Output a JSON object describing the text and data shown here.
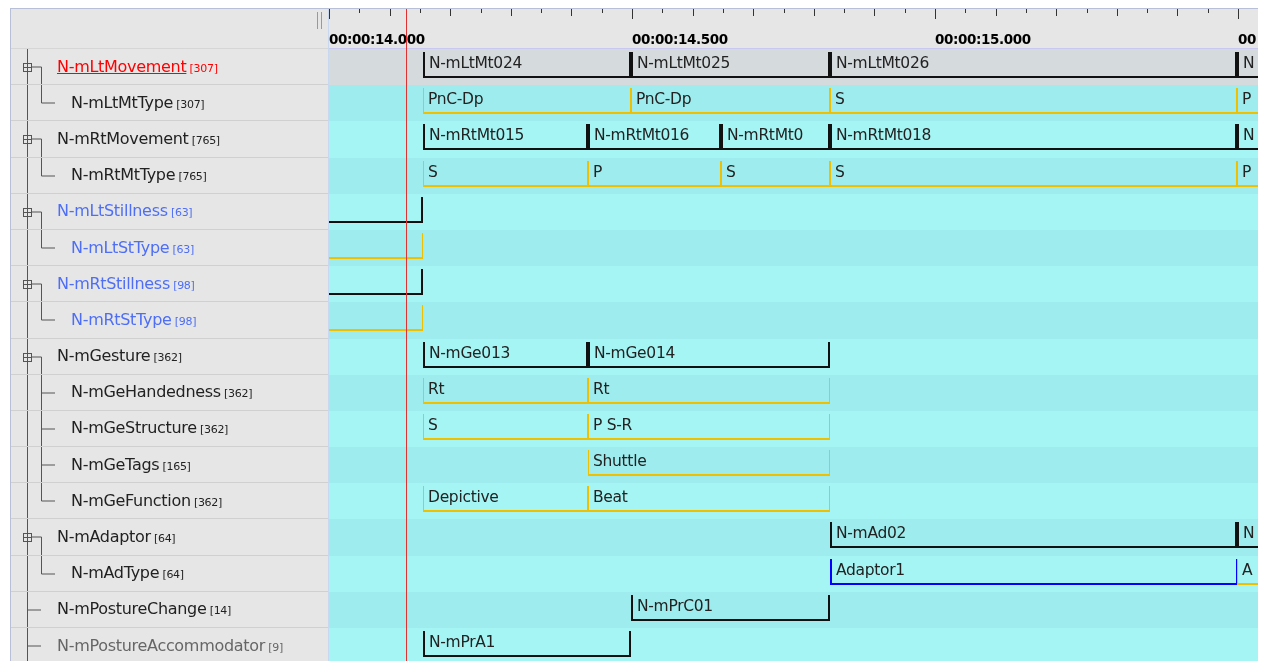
{
  "ruler": {
    "labels": [
      {
        "text": "00:00:14.000"
      },
      {
        "text": "00:00:14.500"
      },
      {
        "text": "00:00:15.000"
      },
      {
        "text": "00"
      }
    ]
  },
  "tiers": [
    {
      "name": "N-mLtMovement",
      "count": "[307]",
      "color": "#ff0000",
      "selected": true,
      "kind": "aligned",
      "annotations": [
        {
          "text": "N-mLtMt024",
          "selected": false
        },
        {
          "text": "N-mLtMt025",
          "selected": false
        },
        {
          "text": "N-mLtMt026",
          "selected": false
        },
        {
          "text": "N",
          "selected": false
        }
      ],
      "children": [
        {
          "name": "N-mLtMtType",
          "count": "[307]",
          "color": "#222222",
          "selected": false,
          "kind": "ref",
          "annotations": [
            {
              "text": "PnC-Dp",
              "selected": false
            },
            {
              "text": "PnC-Dp",
              "selected": false
            },
            {
              "text": "S",
              "selected": false
            },
            {
              "text": "P",
              "selected": false
            }
          ]
        }
      ]
    },
    {
      "name": "N-mRtMovement",
      "count": "[765]",
      "color": "#222222",
      "selected": false,
      "kind": "aligned",
      "annotations": [
        {
          "text": "N-mRtMt015",
          "selected": false
        },
        {
          "text": "N-mRtMt016",
          "selected": false
        },
        {
          "text": "N-mRtMt0",
          "selected": false
        },
        {
          "text": "N-mRtMt018",
          "selected": false
        },
        {
          "text": "N",
          "selected": false
        }
      ],
      "children": [
        {
          "name": "N-mRtMtType",
          "count": "[765]",
          "color": "#222222",
          "selected": false,
          "kind": "ref",
          "annotations": [
            {
              "text": "S",
              "selected": false
            },
            {
              "text": "P",
              "selected": false
            },
            {
              "text": "S",
              "selected": false
            },
            {
              "text": "S",
              "selected": false
            },
            {
              "text": "P",
              "selected": false
            }
          ]
        }
      ]
    },
    {
      "name": "N-mLtStillness",
      "count": "[63]",
      "color": "#4d6ef5",
      "selected": false,
      "kind": "aligned",
      "annotations": [
        {
          "selected": false
        }
      ],
      "children": [
        {
          "name": "N-mLtStType",
          "count": "[63]",
          "color": "#4d6ef5",
          "selected": false,
          "kind": "ref",
          "annotations": [
            {
              "selected": false
            }
          ]
        }
      ]
    },
    {
      "name": "N-mRtStillness",
      "count": "[98]",
      "color": "#4d6ef5",
      "selected": false,
      "kind": "aligned",
      "annotations": [
        {
          "selected": false
        }
      ],
      "children": [
        {
          "name": "N-mRtStType",
          "count": "[98]",
          "color": "#4d6ef5",
          "selected": false,
          "kind": "ref",
          "annotations": [
            {
              "selected": false
            }
          ]
        }
      ]
    },
    {
      "name": "N-mGesture",
      "count": "[362]",
      "color": "#222222",
      "selected": false,
      "kind": "aligned",
      "annotations": [
        {
          "text": "N-mGe013",
          "selected": false
        },
        {
          "text": "N-mGe014",
          "selected": false
        }
      ],
      "children": [
        {
          "name": "N-mGeHandedness",
          "count": "[362]",
          "color": "#222222",
          "selected": false,
          "kind": "ref",
          "annotations": [
            {
              "text": "Rt",
              "selected": false
            },
            {
              "text": "Rt",
              "selected": false
            }
          ]
        },
        {
          "name": "N-mGeStructure",
          "count": "[362]",
          "color": "#222222",
          "selected": false,
          "kind": "ref",
          "annotations": [
            {
              "text": "S",
              "selected": false
            },
            {
              "text": "P S-R",
              "selected": false
            }
          ]
        },
        {
          "name": "N-mGeTags",
          "count": "[165]",
          "color": "#222222",
          "selected": false,
          "kind": "ref",
          "annotations": [
            {
              "text": "Shuttle",
              "selected": false
            }
          ]
        },
        {
          "name": "N-mGeFunction",
          "count": "[362]",
          "color": "#222222",
          "selected": false,
          "kind": "ref",
          "annotations": [
            {
              "text": "Depictive",
              "selected": false
            },
            {
              "text": "Beat",
              "selected": false
            }
          ]
        }
      ]
    },
    {
      "name": "N-mAdaptor",
      "count": "[64]",
      "color": "#222222",
      "selected": false,
      "kind": "aligned",
      "annotations": [
        {
          "text": "N-mAd02",
          "selected": false
        },
        {
          "text": "N",
          "selected": false
        }
      ],
      "children": [
        {
          "name": "N-mAdType",
          "count": "[64]",
          "color": "#222222",
          "selected": false,
          "kind": "ref",
          "annotations": [
            {
              "text": "Adaptor1",
              "selected": true
            },
            {
              "text": "A",
              "selected": false
            }
          ]
        }
      ]
    },
    {
      "name": "N-mPostureChange",
      "count": "[14]",
      "color": "#222222",
      "selected": false,
      "kind": "aligned",
      "annotations": [
        {
          "text": "N-mPrC01",
          "selected": false
        }
      ]
    },
    {
      "name": "N-mPostureAccommodator",
      "count": "[9]",
      "color": "#666666",
      "selected": false,
      "kind": "aligned",
      "annotations": [
        {
          "text": "N-mPrA1",
          "selected": false
        }
      ]
    }
  ]
}
